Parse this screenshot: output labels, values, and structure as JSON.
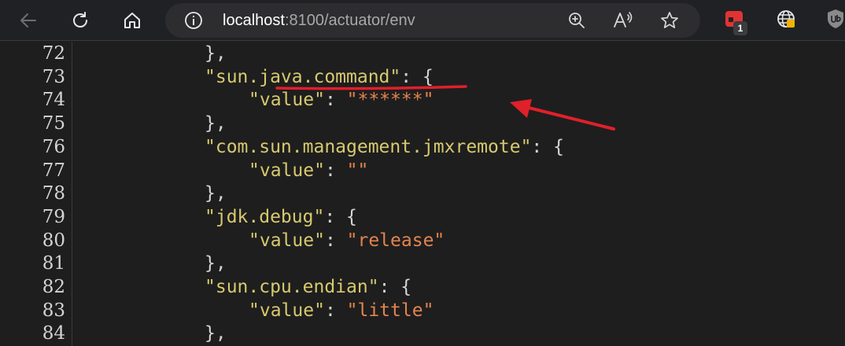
{
  "browser": {
    "url_host": "localhost",
    "url_rest": ":8100/actuator/env",
    "extension_badge": "1"
  },
  "code_lines": [
    {
      "num": "72",
      "indent": 2,
      "tokens": [
        {
          "t": "},",
          "k": "punc"
        }
      ]
    },
    {
      "num": "73",
      "indent": 2,
      "tokens": [
        {
          "t": "\"sun.java.command\"",
          "k": "key"
        },
        {
          "t": ": {",
          "k": "punc"
        }
      ]
    },
    {
      "num": "74",
      "indent": 3,
      "tokens": [
        {
          "t": "\"value\"",
          "k": "key"
        },
        {
          "t": ": ",
          "k": "punc"
        },
        {
          "t": "\"******\"",
          "k": "str"
        }
      ]
    },
    {
      "num": "75",
      "indent": 2,
      "tokens": [
        {
          "t": "},",
          "k": "punc"
        }
      ]
    },
    {
      "num": "76",
      "indent": 2,
      "tokens": [
        {
          "t": "\"com.sun.management.jmxremote\"",
          "k": "key"
        },
        {
          "t": ": {",
          "k": "punc"
        }
      ]
    },
    {
      "num": "77",
      "indent": 3,
      "tokens": [
        {
          "t": "\"value\"",
          "k": "key"
        },
        {
          "t": ": ",
          "k": "punc"
        },
        {
          "t": "\"\"",
          "k": "str"
        }
      ]
    },
    {
      "num": "78",
      "indent": 2,
      "tokens": [
        {
          "t": "},",
          "k": "punc"
        }
      ]
    },
    {
      "num": "79",
      "indent": 2,
      "tokens": [
        {
          "t": "\"jdk.debug\"",
          "k": "key"
        },
        {
          "t": ": {",
          "k": "punc"
        }
      ]
    },
    {
      "num": "80",
      "indent": 3,
      "tokens": [
        {
          "t": "\"value\"",
          "k": "key"
        },
        {
          "t": ": ",
          "k": "punc"
        },
        {
          "t": "\"release\"",
          "k": "str"
        }
      ]
    },
    {
      "num": "81",
      "indent": 2,
      "tokens": [
        {
          "t": "},",
          "k": "punc"
        }
      ]
    },
    {
      "num": "82",
      "indent": 2,
      "tokens": [
        {
          "t": "\"sun.cpu.endian\"",
          "k": "key"
        },
        {
          "t": ": {",
          "k": "punc"
        }
      ]
    },
    {
      "num": "83",
      "indent": 3,
      "tokens": [
        {
          "t": "\"value\"",
          "k": "key"
        },
        {
          "t": ": ",
          "k": "punc"
        },
        {
          "t": "\"little\"",
          "k": "str"
        }
      ]
    },
    {
      "num": "84",
      "indent": 2,
      "tokens": [
        {
          "t": "},",
          "k": "punc"
        }
      ]
    }
  ],
  "icons": {
    "back": "back-arrow-icon",
    "reload": "reload-icon",
    "home": "home-icon",
    "site_info": "info-icon",
    "zoom": "zoom-in-icon",
    "read_aloud": "read-aloud-icon",
    "favorite": "star-icon",
    "ext_red": "extension-red-icon",
    "ext_globe": "globe-extension-icon",
    "ext_shield": "ublock-shield-icon"
  },
  "colors": {
    "json_key": "#d7c96f",
    "json_string": "#e3844e",
    "annotation": "#e0202a"
  }
}
